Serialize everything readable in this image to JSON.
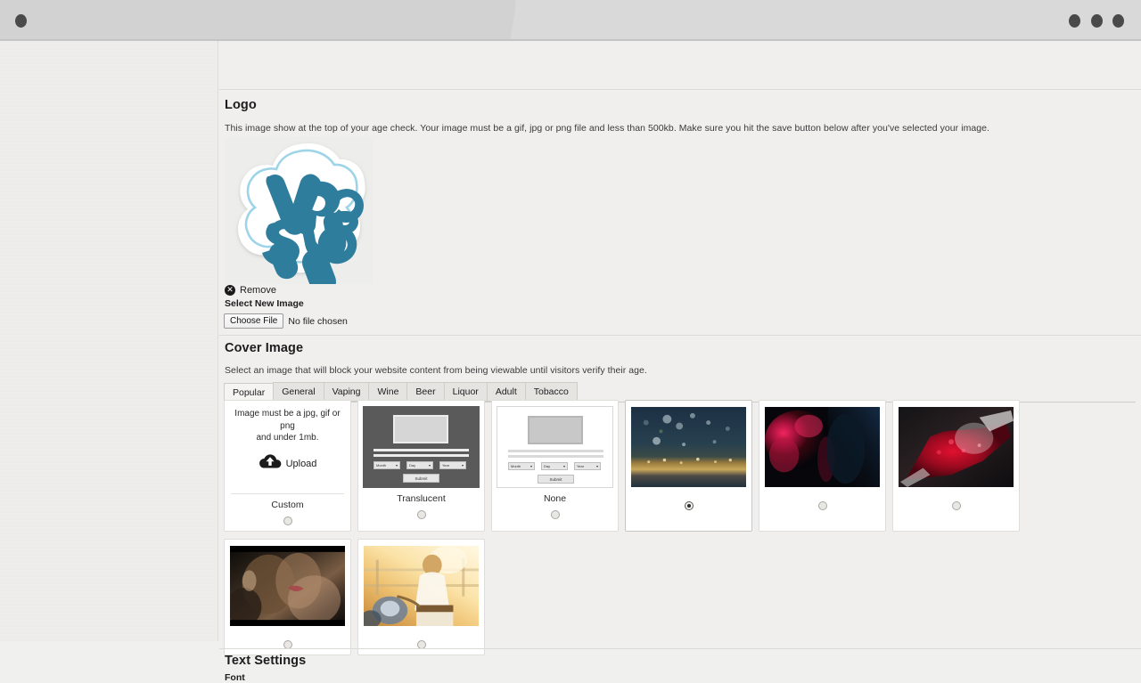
{
  "chrome": {
    "dots": [
      "window-dot",
      "menu-dot-1",
      "menu-dot-2",
      "menu-dot-3"
    ]
  },
  "logo_section": {
    "title": "Logo",
    "description": "This image show at the top of your age check. Your image must be a gif, jpg or png file and less than 500kb. Make sure you hit the save button below after you've selected your image.",
    "logo_alt": "Vape Shop",
    "logo_text_line1": "Vape",
    "logo_text_line2": "Shop",
    "logo_color": "#2f7d9d",
    "logo_outline_color": "#9ed4e8",
    "remove_label": "Remove",
    "remove_icon": "close-circle-icon",
    "select_new_label": "Select New Image",
    "choose_file_label": "Choose File",
    "no_file_label": "No file chosen"
  },
  "cover_section": {
    "title": "Cover Image",
    "description": "Select an image that will block your website content from being viewable until visitors verify their age.",
    "tabs": [
      {
        "label": "Popular",
        "active": true
      },
      {
        "label": "General",
        "active": false
      },
      {
        "label": "Vaping",
        "active": false
      },
      {
        "label": "Wine",
        "active": false
      },
      {
        "label": "Beer",
        "active": false
      },
      {
        "label": "Liquor",
        "active": false
      },
      {
        "label": "Adult",
        "active": false
      },
      {
        "label": "Tobacco",
        "active": false
      }
    ],
    "mock_preview": {
      "month_label": "Month",
      "day_label": "Day",
      "year_label": "Year",
      "caret": "▾",
      "submit_label": "Submit"
    },
    "cards": [
      {
        "kind": "custom",
        "caption": "Custom",
        "message_line1": "Image must be a jpg, gif or png",
        "message_line2": "and under 1mb.",
        "upload_label": "Upload",
        "upload_icon": "cloud-upload-icon",
        "selected": false
      },
      {
        "kind": "translucent",
        "caption": "Translucent",
        "selected": false
      },
      {
        "kind": "none",
        "caption": "None",
        "selected": false
      },
      {
        "kind": "photo",
        "caption": "",
        "photo": "bokeh-gold-night",
        "selected": true
      },
      {
        "kind": "photo",
        "caption": "",
        "photo": "red-smoke-couple",
        "selected": false
      },
      {
        "kind": "photo",
        "caption": "",
        "photo": "red-wine-pour",
        "selected": false
      },
      {
        "kind": "photo",
        "caption": "",
        "photo": "couple-intimate-dark",
        "selected": false
      },
      {
        "kind": "photo",
        "caption": "",
        "photo": "man-scooter-sunset",
        "selected": false
      }
    ]
  },
  "text_section": {
    "title": "Text Settings",
    "font_label": "Font"
  }
}
